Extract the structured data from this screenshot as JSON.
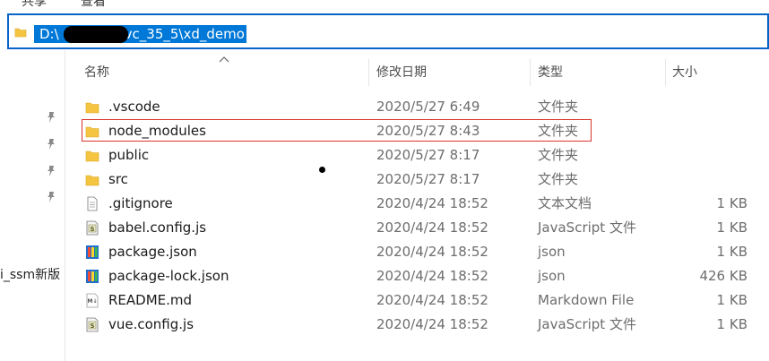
{
  "ribbon": {
    "items": [
      "共享",
      "查看"
    ]
  },
  "address_bar": {
    "path_start": "D:\\",
    "path_end": "vc_35_5\\xd_demo"
  },
  "nav_pane": {
    "partial_label": "i_ssm新版",
    "pin_icons": 4
  },
  "columns": {
    "name": "名称",
    "date": "修改日期",
    "type": "类型",
    "size": "大小"
  },
  "files": [
    {
      "name": ".vscode",
      "date": "2020/5/27 6:49",
      "type": "文件夹",
      "size": "",
      "icon": "folder-icon"
    },
    {
      "name": "node_modules",
      "date": "2020/5/27 8:43",
      "type": "文件夹",
      "size": "",
      "icon": "folder-icon"
    },
    {
      "name": "public",
      "date": "2020/5/27 8:17",
      "type": "文件夹",
      "size": "",
      "icon": "folder-icon"
    },
    {
      "name": "src",
      "date": "2020/5/27 8:17",
      "type": "文件夹",
      "size": "",
      "icon": "folder-icon"
    },
    {
      "name": ".gitignore",
      "date": "2020/4/24 18:52",
      "type": "文本文档",
      "size": "1 KB",
      "icon": "text-file-icon"
    },
    {
      "name": "babel.config.js",
      "date": "2020/4/24 18:52",
      "type": "JavaScript 文件",
      "size": "1 KB",
      "icon": "js-file-icon"
    },
    {
      "name": "package.json",
      "date": "2020/4/24 18:52",
      "type": "json",
      "size": "1 KB",
      "icon": "json-file-icon"
    },
    {
      "name": "package-lock.json",
      "date": "2020/4/24 18:52",
      "type": "json",
      "size": "426 KB",
      "icon": "json-file-icon"
    },
    {
      "name": "README.md",
      "date": "2020/4/24 18:52",
      "type": "Markdown File",
      "size": "1 KB",
      "icon": "markdown-file-icon"
    },
    {
      "name": "vue.config.js",
      "date": "2020/4/24 18:52",
      "type": "JavaScript 文件",
      "size": "1 KB",
      "icon": "js-file-icon"
    }
  ],
  "highlighted_row": 1,
  "colors": {
    "selection": "#0078d7",
    "folder": "#f5c542",
    "highlight_border": "#d9342b"
  }
}
